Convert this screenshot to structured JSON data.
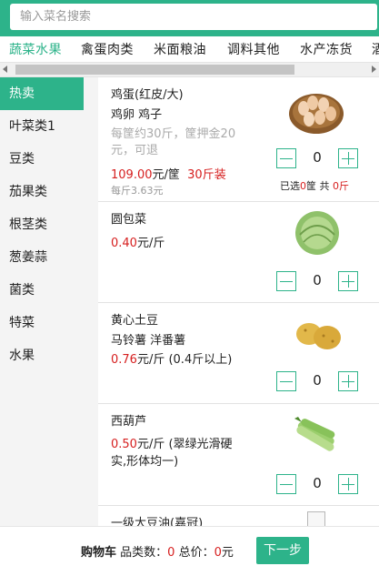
{
  "search": {
    "placeholder": "输入菜名搜索"
  },
  "tabs": [
    "蔬菜水果",
    "禽蛋肉类",
    "米面粮油",
    "调料其他",
    "水产冻货",
    "酒"
  ],
  "sidebar": [
    "热卖",
    "叶菜类1",
    "豆类",
    "茄果类",
    "根茎类",
    "葱姜蒜",
    "菌类",
    "特菜",
    "水果"
  ],
  "products": [
    {
      "name": "鸡蛋(红皮/大)",
      "desc": "鸡卵 鸡子",
      "note": "每筐约30斤，筐押金20元，可退",
      "price": "109.00",
      "unit": "元/筐",
      "pack": "30斤装",
      "per_jin": "每斤3.63元",
      "qty": "0",
      "selected_label1": "已选",
      "selected_value1": "0",
      "selected_unit1": "筐 共 ",
      "selected_value2": "0",
      "selected_unit2": "斤",
      "image_icon": "eggs-basket"
    },
    {
      "name": "圆包菜",
      "price": "0.40",
      "unit": "元/斤",
      "qty": "0",
      "image_icon": "cabbage"
    },
    {
      "name": "黄心土豆",
      "desc": "马铃薯 洋番薯",
      "price": "0.76",
      "unit": "元/斤 (0.4斤以上)",
      "qty": "0",
      "image_icon": "potato"
    },
    {
      "name": "西葫芦",
      "price": "0.50",
      "unit": "元/斤 (翠绿光滑硬",
      "unit_line2": "实,形体均一)",
      "qty": "0",
      "image_icon": "zucchini"
    },
    {
      "name": "一级大豆油(嘉冠)",
      "image_icon": "broken-image"
    }
  ],
  "cart": {
    "label": "购物车",
    "count_label": " 品类数：",
    "count": "0",
    "total_label": " 总价：",
    "total": "0",
    "currency": "元",
    "next_label": "下一步"
  },
  "colors": {
    "accent": "#2db38a",
    "price_red": "#d61f1f"
  }
}
